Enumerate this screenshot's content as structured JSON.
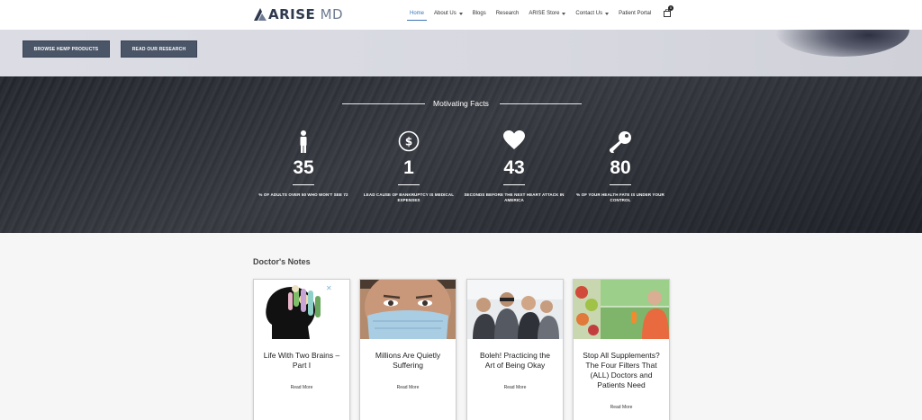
{
  "header": {
    "logo": {
      "brand_main": "ARISE",
      "brand_suffix": "MD",
      "icon": "arise-logo-icon"
    },
    "nav": [
      {
        "label": "Home",
        "active": true,
        "dropdown": false
      },
      {
        "label": "About Us",
        "active": false,
        "dropdown": true
      },
      {
        "label": "Blogs",
        "active": false,
        "dropdown": false
      },
      {
        "label": "Research",
        "active": false,
        "dropdown": false
      },
      {
        "label": "ARISE Store",
        "active": false,
        "dropdown": true
      },
      {
        "label": "Contact Us",
        "active": false,
        "dropdown": true
      },
      {
        "label": "Patient Portal",
        "active": false,
        "dropdown": false
      }
    ],
    "cart": {
      "icon": "shopping-bag-icon",
      "count": "0"
    }
  },
  "hero": {
    "buttons": [
      {
        "label": "BROWSE HEMP PRODUCTS"
      },
      {
        "label": "READ OUR RESEARCH"
      }
    ]
  },
  "facts": {
    "title": "Motivating Facts",
    "items": [
      {
        "icon": "person-icon",
        "number": "35",
        "label": "% OF ADULTS OVER 50 WHO WON'T SEE 72"
      },
      {
        "icon": "dollar-circle-icon",
        "number": "1",
        "label": "LEAD CAUSE OF BANKRUPTCY IS MEDICAL EXPENSES"
      },
      {
        "icon": "heart-icon",
        "number": "43",
        "label": "SECONDS BEFORE THE NEXT HEART ATTACK IN AMERICA"
      },
      {
        "icon": "key-icon",
        "number": "80",
        "label": "% OF YOUR HEALTH FATE IS UNDER YOUR CONTROL"
      }
    ]
  },
  "notes": {
    "title": "Doctor's Notes",
    "cards": [
      {
        "title": "Life With Two Brains – Part I",
        "link": "Read More"
      },
      {
        "title": "Millions Are Quietly Suffering",
        "link": "Read More"
      },
      {
        "title": "Boleh! Practicing the Art of Being Okay",
        "link": "Read More"
      },
      {
        "title": "Stop All Supplements? The Four Filters That (ALL) Doctors and Patients Need",
        "link": "Read More"
      }
    ]
  },
  "colors": {
    "accent": "#3b75b8",
    "button_bg": "#4a5568",
    "header_bg": "#ffffff",
    "page_bg": "#f6f6f6"
  }
}
